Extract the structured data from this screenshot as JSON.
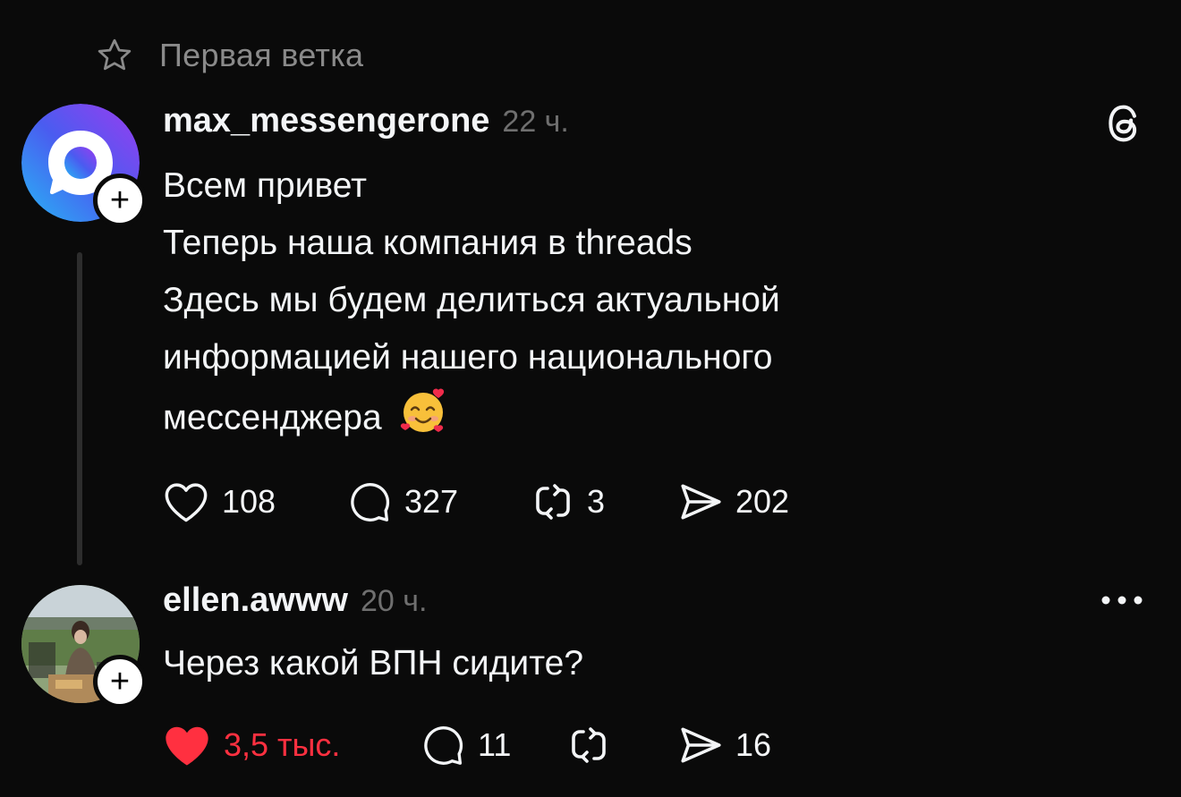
{
  "thread_header": {
    "title": "Первая ветка",
    "icon": "star-icon"
  },
  "posts": [
    {
      "username": "max_messengerone",
      "time": "22 ч.",
      "avatar_icon": "max-logo-avatar",
      "lines": [
        "Всем привет",
        "Теперь наша компания в threads",
        "Здесь мы будем делиться актуальной",
        "информацией нашего национального",
        "мессенджера"
      ],
      "emoji": "smiling-face-with-hearts",
      "likes": "108",
      "replies": "327",
      "reposts": "3",
      "shares": "202",
      "corner_icon": "threads-logo-icon"
    },
    {
      "username": "ellen.awww",
      "time": "20 ч.",
      "avatar_icon": "user-photo-avatar",
      "lines": [
        "Через какой ВПН сидите?"
      ],
      "likes": "3,5 тыс.",
      "liked": true,
      "replies": "11",
      "reposts": "",
      "shares": "16",
      "corner_icon": "more-options-icon"
    }
  ],
  "colors": {
    "background": "#0a0a0a",
    "text": "#f3f5f7",
    "muted": "#6f6f6f",
    "like_active": "#ff3040"
  }
}
